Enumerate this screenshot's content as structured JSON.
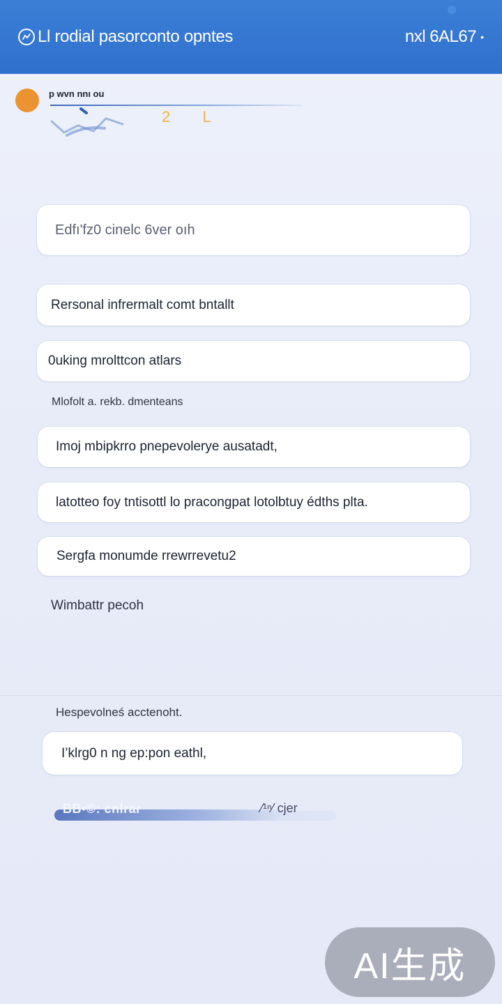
{
  "header": {
    "title": "Ll rodial pasorconto opntes",
    "version": "nxl 6AL67",
    "version_suffix": "•"
  },
  "profile": {
    "name": "p wvn nnı ou",
    "marks": "2 L"
  },
  "cards": [
    {
      "label": "Edfı'fz0 cinelc 6ver oıh"
    },
    {
      "label": "Rersonal infrermalt comt bntallt"
    },
    {
      "label": "0uking mrolttcon atlars"
    }
  ],
  "section_note": "Mlofolt a. rekb. dmenteans",
  "options": [
    {
      "label": "Imoj mbipkrro pnepevolerye ausatadt,"
    },
    {
      "label": "latotteo foy tntisottl lo pracongpat lotolbtuy édths plta."
    },
    {
      "label": "Sergfa monumde rrewrrevetu2"
    }
  ],
  "footer_link": "Wimbattr pecoh",
  "lower_section_label": "Hespevolneś acctenoht.",
  "lower_card": {
    "label": "I’klrg0 n ng ep:pon eathl,"
  },
  "progress": {
    "left_label": "BB•©: cnlrar",
    "right_label": "⁄¹ⁿ⁄ cjer",
    "fill_fraction": 0.8
  },
  "watermark": "AI生成"
}
